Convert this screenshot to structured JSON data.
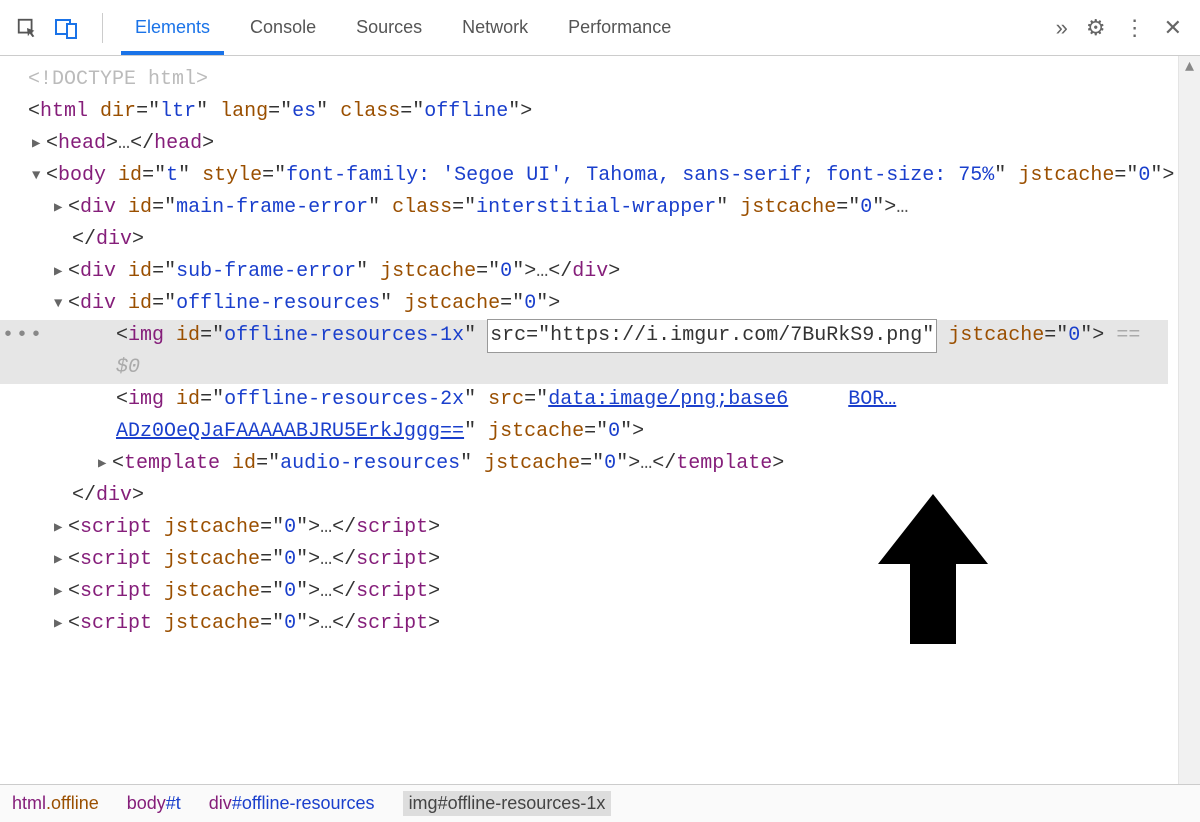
{
  "toolbar": {
    "tabs": [
      "Elements",
      "Console",
      "Sources",
      "Network",
      "Performance"
    ],
    "more_tabs_glyph": "»",
    "settings_glyph": "⚙",
    "menu_glyph": "⋮",
    "close_glyph": "✕"
  },
  "code": {
    "doctype": "<!DOCTYPE html>",
    "html_open": {
      "tag": "html",
      "attrs": [
        [
          "dir",
          "ltr"
        ],
        [
          "lang",
          "es"
        ],
        [
          "class",
          "offline"
        ]
      ]
    },
    "head": {
      "tag": "head"
    },
    "body_open": {
      "tag": "body",
      "attrs_part1": [
        [
          "id",
          "t"
        ]
      ],
      "style_key": "style",
      "style_val": "font-family: 'Segoe UI', Tahoma, sans-serif; font-size: 75%",
      "attrs_part2": [
        [
          "jstcache",
          "0"
        ]
      ]
    },
    "main_error": {
      "tag": "div",
      "attrs": [
        [
          "id",
          "main-frame-error"
        ],
        [
          "class",
          "interstitial-wrapper"
        ],
        [
          "jstcache",
          "0"
        ]
      ]
    },
    "sub_error": {
      "tag": "div",
      "attrs": [
        [
          "id",
          "sub-frame-error"
        ],
        [
          "jstcache",
          "0"
        ]
      ]
    },
    "offline_res": {
      "tag": "div",
      "attrs": [
        [
          "id",
          "offline-resources"
        ],
        [
          "jstcache",
          "0"
        ]
      ]
    },
    "img1": {
      "tag": "img",
      "id_key": "id",
      "id_val": "offline-resources-1x",
      "src_key": "src",
      "src_edit": "src=\"https://i.imgur.com/7BuRkS9.png\"",
      "tail_attr_key": "jstcache",
      "tail_attr_val": "0",
      "eqdollar": "== $0"
    },
    "img2": {
      "tag": "img",
      "attrs": [
        [
          "id",
          "offline-resources-2x"
        ]
      ],
      "src_key": "src",
      "src_link_a": "data:image/png;base6",
      "src_link_b": "BOR…",
      "src_link_c": "ADz0OeQJaFAAAAABJRU5ErkJggg==",
      "tail": [
        [
          "jstcache",
          "0"
        ]
      ]
    },
    "template": {
      "tag": "template",
      "attrs": [
        [
          "id",
          "audio-resources"
        ],
        [
          "jstcache",
          "0"
        ]
      ]
    },
    "script": {
      "tag": "script",
      "attrs": [
        [
          "jstcache",
          "0"
        ]
      ]
    }
  },
  "breadcrumbs": {
    "a_tag": "html",
    "a_cls": ".offline",
    "b_tag": "body",
    "b_id": "#t",
    "c_tag": "div",
    "c_id": "#offline-resources",
    "d_tag": "img",
    "d_id": "#offline-resources-1x"
  }
}
